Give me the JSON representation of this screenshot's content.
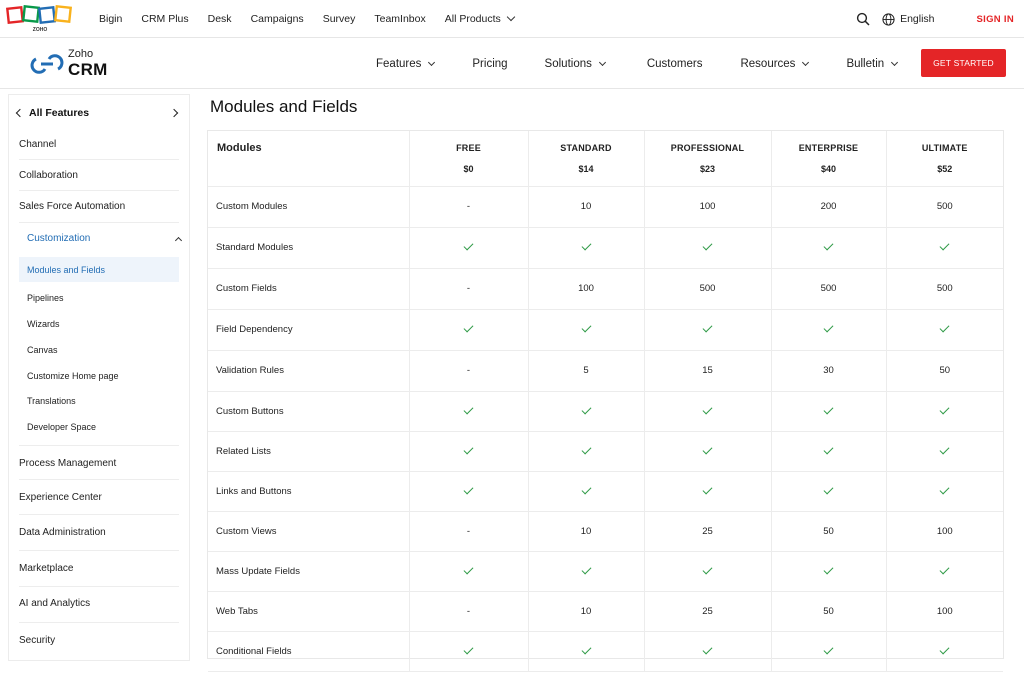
{
  "topnav": {
    "items": [
      "Bigin",
      "CRM Plus",
      "Desk",
      "Campaigns",
      "Survey",
      "TeamInbox",
      "All Products"
    ],
    "language": "English",
    "signin": "SIGN IN"
  },
  "brand": {
    "small": "Zoho",
    "big": "CRM",
    "logo_text": "ZOHO"
  },
  "prodnav": {
    "items": [
      "Features",
      "Pricing",
      "Solutions",
      "Customers",
      "Resources",
      "Bulletin"
    ],
    "cta": "GET STARTED"
  },
  "sidebar": {
    "header": "All Features",
    "items_top": [
      "Channel",
      "Collaboration",
      "Sales Force Automation"
    ],
    "active_group": "Customization",
    "sub_items": [
      "Modules and Fields",
      "Pipelines",
      "Wizards",
      "Canvas",
      "Customize Home page",
      "Translations",
      "Developer Space"
    ],
    "items_bottom": [
      "Process Management",
      "Experience Center",
      "Data Administration",
      "Marketplace",
      "AI and Analytics",
      "Security"
    ]
  },
  "page": {
    "title": "Modules and Fields"
  },
  "table": {
    "header_first": "Modules",
    "tiers": [
      {
        "name": "FREE",
        "price": "$0"
      },
      {
        "name": "STANDARD",
        "price": "$14"
      },
      {
        "name": "PROFESSIONAL",
        "price": "$23"
      },
      {
        "name": "ENTERPRISE",
        "price": "$40"
      },
      {
        "name": "ULTIMATE",
        "price": "$52"
      }
    ],
    "rows": [
      {
        "feature": "Custom Modules",
        "values": [
          "-",
          "10",
          "100",
          "200",
          "500"
        ]
      },
      {
        "feature": "Standard Modules",
        "values": [
          "✓",
          "✓",
          "✓",
          "✓",
          "✓"
        ]
      },
      {
        "feature": "Custom Fields",
        "values": [
          "-",
          "100",
          "500",
          "500",
          "500"
        ]
      },
      {
        "feature": "Field Dependency",
        "values": [
          "✓",
          "✓",
          "✓",
          "✓",
          "✓"
        ]
      },
      {
        "feature": "Validation Rules",
        "values": [
          "-",
          "5",
          "15",
          "30",
          "50"
        ]
      },
      {
        "feature": "Custom Buttons",
        "values": [
          "✓",
          "✓",
          "✓",
          "✓",
          "✓"
        ]
      },
      {
        "feature": "Related Lists",
        "values": [
          "✓",
          "✓",
          "✓",
          "✓",
          "✓"
        ]
      },
      {
        "feature": "Links and Buttons",
        "values": [
          "✓",
          "✓",
          "✓",
          "✓",
          "✓"
        ]
      },
      {
        "feature": "Custom Views",
        "values": [
          "-",
          "10",
          "25",
          "50",
          "100"
        ]
      },
      {
        "feature": "Mass Update Fields",
        "values": [
          "✓",
          "✓",
          "✓",
          "✓",
          "✓"
        ]
      },
      {
        "feature": "Web Tabs",
        "values": [
          "-",
          "10",
          "25",
          "50",
          "100"
        ]
      },
      {
        "feature": "Conditional Fields",
        "values": [
          "✓",
          "✓",
          "✓",
          "✓",
          "✓"
        ]
      }
    ]
  },
  "colors": {
    "accent_red": "#e42527",
    "link_blue": "#226db4",
    "check_green": "#2e9a46"
  },
  "icons": [
    "search-icon",
    "globe-icon",
    "zoho-logo-icon",
    "crm-logo-icon",
    "chevron-down-icon",
    "chevron-left-icon",
    "chevron-right-icon",
    "chevron-up-icon",
    "check-icon"
  ]
}
